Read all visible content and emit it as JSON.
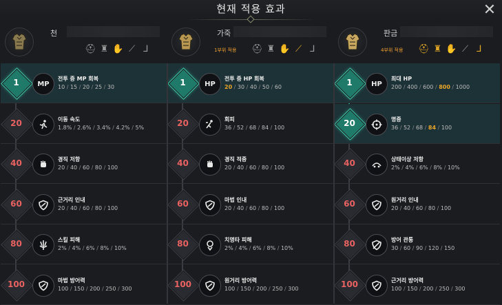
{
  "window": {
    "title": "현재 적용 효과"
  },
  "columns": [
    {
      "set_name": "천",
      "set_sub": "",
      "set_icon": "cloth-armor-icon",
      "pieces": [
        {
          "icon": "helmet-icon",
          "on": false
        },
        {
          "icon": "chest-armor-icon",
          "on": false
        },
        {
          "icon": "gloves-icon",
          "on": false
        },
        {
          "icon": "weapon-icon",
          "on": false
        },
        {
          "icon": "boots-icon",
          "on": false
        }
      ],
      "effects": [
        {
          "level": "1",
          "icon_text": "MP",
          "icon": "mp-icon",
          "name": "전투 중 MP 회복",
          "values": [
            "10",
            "15",
            "20",
            "25",
            "30"
          ],
          "highlight": -1,
          "active": true
        },
        {
          "level": "20",
          "icon_text": "",
          "icon": "running-icon",
          "name": "이동 속도",
          "values": [
            "1.8%",
            "2.6%",
            "3.4%",
            "4.2%",
            "5%"
          ],
          "highlight": -1,
          "active": false
        },
        {
          "level": "40",
          "icon_text": "",
          "icon": "fist-icon",
          "name": "경직 저항",
          "values": [
            "20",
            "40",
            "60",
            "80",
            "100"
          ],
          "highlight": -1,
          "active": false
        },
        {
          "level": "60",
          "icon_text": "",
          "icon": "shield-icon",
          "name": "근거리 인내",
          "values": [
            "20",
            "40",
            "60",
            "80",
            "100"
          ],
          "highlight": -1,
          "active": false
        },
        {
          "level": "80",
          "icon_text": "",
          "icon": "spike-icon",
          "name": "스킬 피해",
          "values": [
            "2%",
            "4%",
            "6%",
            "8%",
            "10%"
          ],
          "highlight": -1,
          "active": false
        },
        {
          "level": "100",
          "icon_text": "",
          "icon": "shield-icon",
          "name": "마법 방어력",
          "values": [
            "100",
            "150",
            "200",
            "250",
            "300"
          ],
          "highlight": -1,
          "active": false
        }
      ]
    },
    {
      "set_name": "가죽",
      "set_sub": "1부위 적용",
      "set_icon": "leather-armor-icon",
      "pieces": [
        {
          "icon": "helmet-icon",
          "on": false
        },
        {
          "icon": "chest-armor-icon",
          "on": false
        },
        {
          "icon": "gloves-icon",
          "on": false
        },
        {
          "icon": "weapon-icon",
          "on": true
        },
        {
          "icon": "boots-icon",
          "on": false
        }
      ],
      "effects": [
        {
          "level": "1",
          "icon_text": "HP",
          "icon": "hp-icon",
          "name": "전투 중 HP 회복",
          "values": [
            "20",
            "30",
            "40",
            "50",
            "60"
          ],
          "highlight": 0,
          "active": true
        },
        {
          "level": "20",
          "icon_text": "",
          "icon": "dodge-icon",
          "name": "회피",
          "values": [
            "36",
            "52",
            "68",
            "84",
            "100"
          ],
          "highlight": -1,
          "active": false
        },
        {
          "level": "40",
          "icon_text": "",
          "icon": "fist-icon",
          "name": "경직 적중",
          "values": [
            "20",
            "40",
            "60",
            "80",
            "100"
          ],
          "highlight": -1,
          "active": false
        },
        {
          "level": "60",
          "icon_text": "",
          "icon": "shield-icon",
          "name": "마법 인내",
          "values": [
            "20",
            "40",
            "60",
            "80",
            "100"
          ],
          "highlight": -1,
          "active": false
        },
        {
          "level": "80",
          "icon_text": "",
          "icon": "critical-icon",
          "name": "치명타 피해",
          "values": [
            "2%",
            "4%",
            "6%",
            "8%",
            "10%"
          ],
          "highlight": -1,
          "active": false
        },
        {
          "level": "100",
          "icon_text": "",
          "icon": "shield-icon",
          "name": "원거리 방어력",
          "values": [
            "100",
            "150",
            "200",
            "250",
            "300"
          ],
          "highlight": -1,
          "active": false
        }
      ]
    },
    {
      "set_name": "판금",
      "set_sub": "4부위 적용",
      "set_icon": "plate-armor-icon",
      "pieces": [
        {
          "icon": "helmet-icon",
          "on": true
        },
        {
          "icon": "chest-armor-icon",
          "on": true
        },
        {
          "icon": "gloves-icon",
          "on": true
        },
        {
          "icon": "weapon-icon",
          "on": false
        },
        {
          "icon": "boots-icon",
          "on": true
        }
      ],
      "effects": [
        {
          "level": "1",
          "icon_text": "HP",
          "icon": "hp-icon",
          "name": "최대 HP",
          "values": [
            "200",
            "400",
            "600",
            "800",
            "1000"
          ],
          "highlight": 3,
          "active": true
        },
        {
          "level": "20",
          "icon_text": "",
          "icon": "crosshair-icon",
          "name": "명중",
          "values": [
            "36",
            "52",
            "68",
            "84",
            "100"
          ],
          "highlight": 3,
          "active": true
        },
        {
          "level": "40",
          "icon_text": "",
          "icon": "status-resist-icon",
          "name": "상태이상 저항",
          "values": [
            "2%",
            "4%",
            "6%",
            "8%",
            "10%"
          ],
          "highlight": -1,
          "active": false
        },
        {
          "level": "60",
          "icon_text": "",
          "icon": "shield-icon",
          "name": "원거리 인내",
          "values": [
            "20",
            "40",
            "60",
            "80",
            "100"
          ],
          "highlight": -1,
          "active": false
        },
        {
          "level": "80",
          "icon_text": "",
          "icon": "shield-pierce-icon",
          "name": "방어 관통",
          "values": [
            "30",
            "60",
            "90",
            "120",
            "150"
          ],
          "highlight": -1,
          "active": false
        },
        {
          "level": "100",
          "icon_text": "",
          "icon": "shield-icon",
          "name": "근거리 방어력",
          "values": [
            "100",
            "150",
            "200",
            "250",
            "300"
          ],
          "highlight": -1,
          "active": false
        }
      ]
    }
  ],
  "colors": {
    "highlight": "#e9a52a",
    "active_row": "#1d3237",
    "active_diamond": "#1f7a6a",
    "level_text": "#e86262"
  }
}
